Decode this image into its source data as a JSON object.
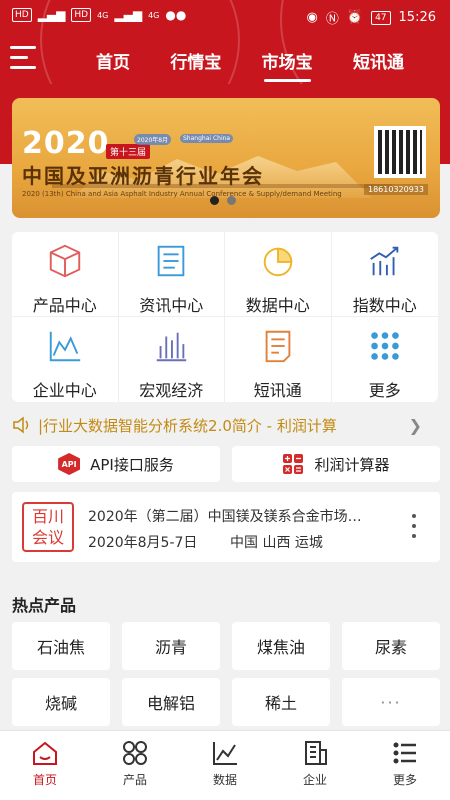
{
  "status_bar": {
    "network_chips": [
      "HD",
      "HD"
    ],
    "signal_labels": [
      "4G",
      "4G"
    ],
    "battery": "47",
    "time": "15:26"
  },
  "header": {
    "tabs": [
      {
        "label": "首页",
        "active": false
      },
      {
        "label": "行情宝",
        "active": false
      },
      {
        "label": "市场宝",
        "active": true
      },
      {
        "label": "短讯通",
        "active": false
      }
    ],
    "accent_color": "#c8161e"
  },
  "banner": {
    "year": "2020",
    "edition": "第十三届",
    "date_chip": "2020年8月",
    "place_chip": "Shanghai China",
    "title": "中国及亚洲沥青行业年会",
    "subtitle": "2020 (13th) China and Asia Asphalt Industry Annual Conference & Supply/demand Meeting",
    "phone": "18610320933",
    "slides": 2,
    "active_slide": 0
  },
  "functions": [
    {
      "label": "产品中心",
      "icon": "box-icon"
    },
    {
      "label": "资讯中心",
      "icon": "document-icon"
    },
    {
      "label": "数据中心",
      "icon": "pie-chart-icon"
    },
    {
      "label": "指数中心",
      "icon": "trend-bar-icon"
    },
    {
      "label": "企业中心",
      "icon": "area-chart-icon"
    },
    {
      "label": "宏观经济",
      "icon": "bar-columns-icon"
    },
    {
      "label": "短讯通",
      "icon": "notepad-icon"
    },
    {
      "label": "更多",
      "icon": "grid-dots-icon"
    }
  ],
  "notice": {
    "text": "|行业大数据智能分析系统2.0简介 - 利润计算"
  },
  "quick_buttons": [
    {
      "label": "API接口服务",
      "icon": "api-badge-icon"
    },
    {
      "label": "利润计算器",
      "icon": "calculator-icon"
    }
  ],
  "meeting": {
    "badge_line1": "百川",
    "badge_line2": "会议",
    "title": "2020年（第二届）中国镁及镁系合金市场…",
    "date": "2020年8月5-7日",
    "place": "中国 山西 运城"
  },
  "hot_products": {
    "title": "热点产品",
    "items": [
      "石油焦",
      "沥青",
      "煤焦油",
      "尿素",
      "烧碱",
      "电解铝",
      "稀土",
      "···"
    ]
  },
  "bottom_nav": [
    {
      "label": "首页",
      "icon": "home-icon",
      "active": true
    },
    {
      "label": "产品",
      "icon": "products-icon",
      "active": false
    },
    {
      "label": "数据",
      "icon": "data-chart-icon",
      "active": false
    },
    {
      "label": "企业",
      "icon": "building-icon",
      "active": false
    },
    {
      "label": "更多",
      "icon": "list-icon",
      "active": false
    }
  ]
}
